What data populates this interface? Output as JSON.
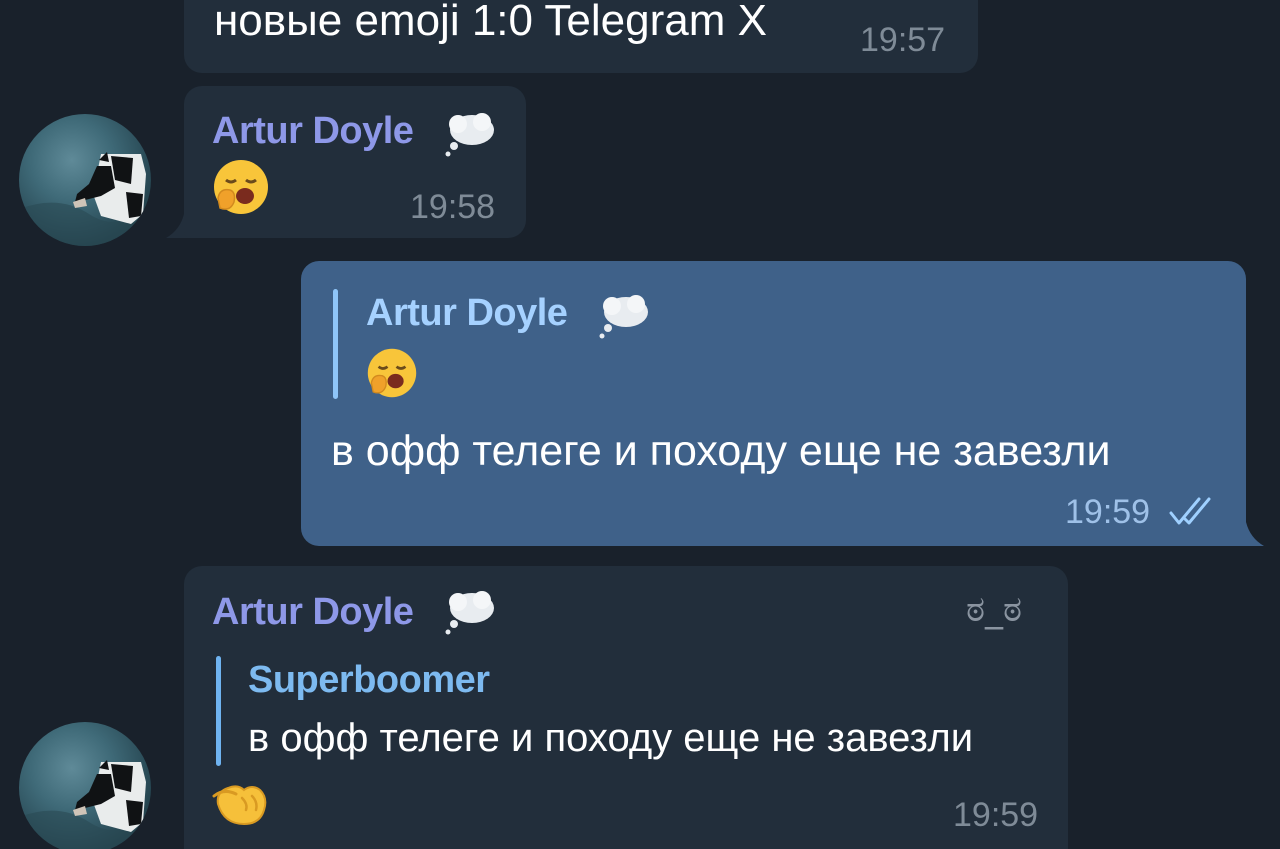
{
  "messages": {
    "m1": {
      "text": "новые emoji 1:0 Telegram X",
      "time": "19:57"
    },
    "m2": {
      "sender": "Artur Doyle",
      "emoji_icon": "yawning-face-icon",
      "time": "19:58"
    },
    "m3": {
      "quote_sender": "Artur Doyle",
      "quote_emoji_icon": "yawning-face-icon",
      "text": "в офф телеге и походу еще не завезли",
      "time": "19:59",
      "status_icon": "double-check-icon"
    },
    "m4": {
      "sender": "Artur Doyle",
      "sender_badge": "ಠ_ಠ",
      "reply_to_name": "Superboomer",
      "reply_to_text": "в офф телеге и походу еще не завезли",
      "emoji_icon": "pinching-hand-icon",
      "time": "19:59"
    }
  },
  "colors": {
    "background": "#19212b",
    "incoming_bubble": "#222e3b",
    "outgoing_bubble": "#3f6189",
    "sender_name": "#8e98e8",
    "reply_name": "#7dbaf0"
  }
}
